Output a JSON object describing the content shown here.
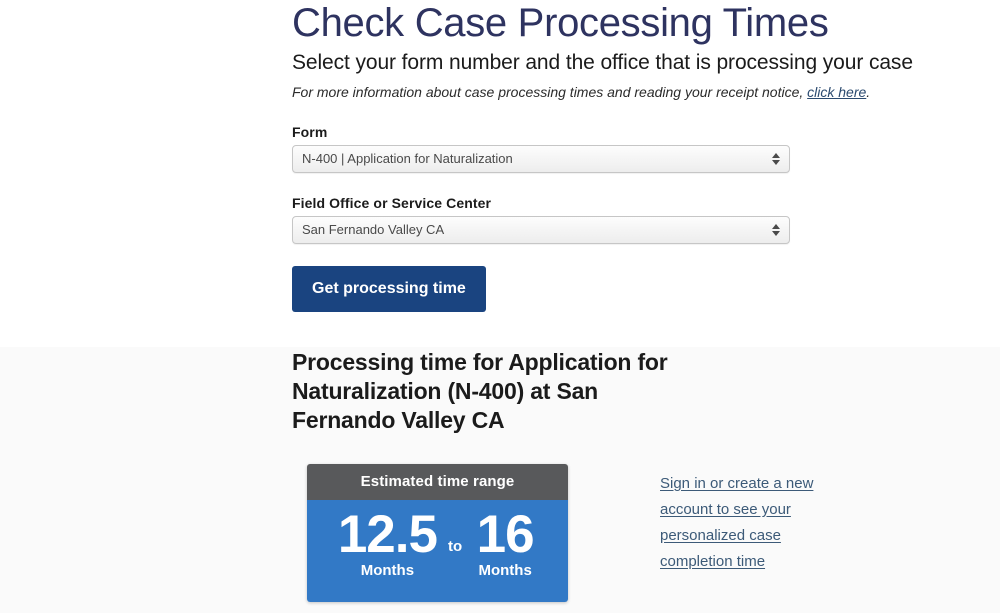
{
  "header": {
    "title": "Check Case Processing Times",
    "subtitle": "Select your form number and the office that is processing your case",
    "note_before": "For more information about case processing times and reading your receipt notice, ",
    "note_link": "click here",
    "note_after": "."
  },
  "form": {
    "form_label": "Form",
    "form_value": "N-400 | Application for Naturalization",
    "office_label": "Field Office or Service Center",
    "office_value": "San Fernando Valley CA",
    "submit_label": "Get processing time"
  },
  "results": {
    "heading": "Processing time for Application for Naturalization (N-400) at San Fernando Valley CA",
    "card": {
      "header": "Estimated time range",
      "low_value": "12.5",
      "low_unit": "Months",
      "separator": "to",
      "high_value": "16",
      "high_unit": "Months"
    },
    "signin_lines": [
      "Sign in or create a new",
      "account to see your",
      "personalized case",
      "completion time"
    ]
  },
  "colors": {
    "title_navy": "#2e3360",
    "button_blue": "#1a4480",
    "card_blue": "#3279c6",
    "card_gray": "#58595b",
    "link_blue": "#3c5a78",
    "panel_bg": "#fafafa"
  }
}
